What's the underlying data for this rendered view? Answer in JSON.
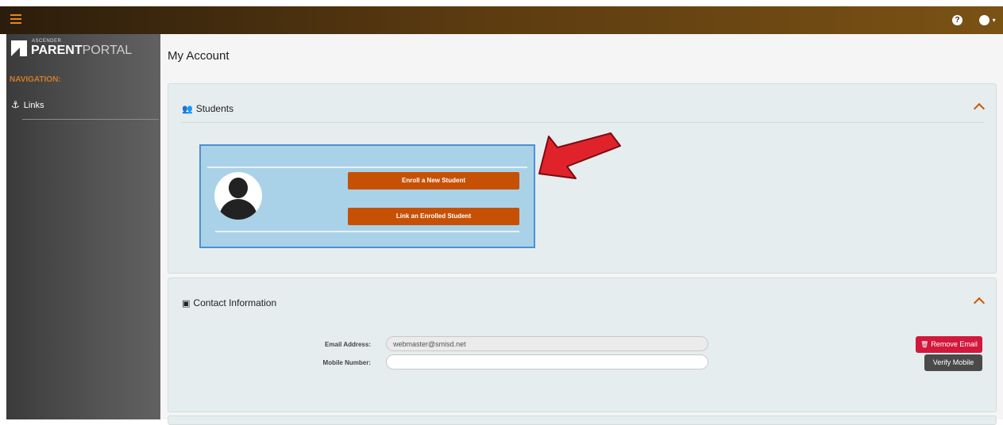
{
  "header": {
    "help_icon": "question-icon",
    "user_icon": "user-circle-icon"
  },
  "sidebar": {
    "logo_small": "ASCENDER",
    "logo_bold": "PARENT",
    "logo_light": "PORTAL",
    "nav_title": "NAVIGATION:",
    "items": [
      {
        "label": "Links",
        "icon": "anchor-icon"
      }
    ]
  },
  "main": {
    "title": "My Account",
    "students": {
      "title": "Students",
      "enroll_label": "Enroll a New Student",
      "link_label": "Link an Enrolled Student"
    },
    "contact": {
      "title": "Contact Information",
      "email_label": "Email Address:",
      "email_value": "webmaster@smisd.net",
      "mobile_label": "Mobile Number:",
      "mobile_value": "",
      "remove_email_label": "Remove Email",
      "verify_mobile_label": "Verify Mobile"
    }
  },
  "colors": {
    "accent": "#c65105",
    "danger": "#d2183c",
    "arrow": "#e0232a"
  }
}
